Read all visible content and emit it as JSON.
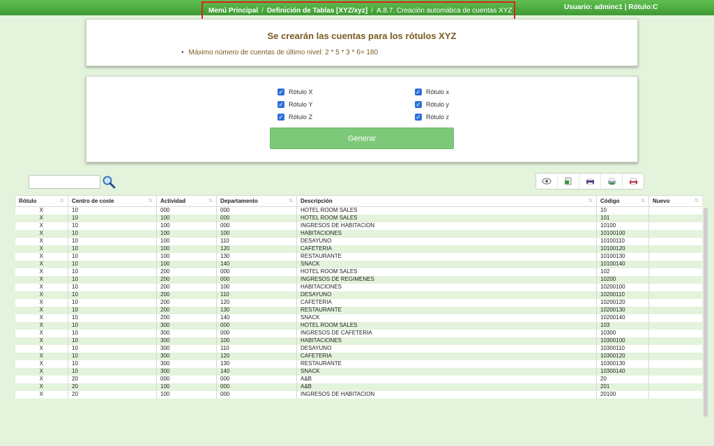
{
  "breadcrumb": {
    "items": [
      "Menú Principal",
      "Definición de Tablas [XYZ/xyz]"
    ],
    "current": "A.8.7. Creación automática de cuentas XYZ",
    "separator": "/"
  },
  "user": {
    "info": "Usuario: adminc1 | Rótulo:C"
  },
  "info_panel": {
    "title": "Se crearán las cuentas para los rótulos XYZ",
    "bullet": "Máximo número de cuentas de último nivel: 2 * 5 * 3 * 6= 180"
  },
  "options": [
    {
      "label": "Rótulo X",
      "checked": true
    },
    {
      "label": "Rótulo Y",
      "checked": true
    },
    {
      "label": "Rótulo Z",
      "checked": true
    },
    {
      "label": "Rótulo x",
      "checked": true
    },
    {
      "label": "Rótulo y",
      "checked": true
    },
    {
      "label": "Rótulo z",
      "checked": true
    }
  ],
  "generate_label": "Generar",
  "search": {
    "value": "",
    "icon": "magnifier-icon"
  },
  "toolbar_icons": [
    "eye-icon",
    "csv-icon",
    "print-icon",
    "copy-icon",
    "pdf-icon"
  ],
  "table": {
    "columns": [
      "Rótulo",
      "Centro de coste",
      "Actividad",
      "Departamento",
      "Descripción",
      "Código",
      "Nuevo"
    ],
    "rows": [
      [
        "X",
        "10",
        "000",
        "000",
        "HOTEL ROOM SALES",
        "10",
        ""
      ],
      [
        "X",
        "10",
        "100",
        "000",
        "HOTEL ROOM SALES",
        "101",
        ""
      ],
      [
        "X",
        "10",
        "100",
        "000",
        "INGRESOS DE HABITACION",
        "10100",
        ""
      ],
      [
        "X",
        "10",
        "100",
        "100",
        "HABITACIONES",
        "10100100",
        ""
      ],
      [
        "X",
        "10",
        "100",
        "110",
        "DESAYUNO",
        "10100110",
        ""
      ],
      [
        "X",
        "10",
        "100",
        "120",
        "CAFETERIA",
        "10100120",
        ""
      ],
      [
        "X",
        "10",
        "100",
        "130",
        "RESTAURANTE",
        "10100130",
        ""
      ],
      [
        "X",
        "10",
        "100",
        "140",
        "SNACK",
        "10100140",
        ""
      ],
      [
        "X",
        "10",
        "200",
        "000",
        "HOTEL ROOM SALES",
        "102",
        ""
      ],
      [
        "X",
        "10",
        "200",
        "000",
        "INGRESOS DE REGIMENES",
        "10200",
        ""
      ],
      [
        "X",
        "10",
        "200",
        "100",
        "HABITACIONES",
        "10200100",
        ""
      ],
      [
        "X",
        "10",
        "200",
        "110",
        "DESAYUNO",
        "10200110",
        ""
      ],
      [
        "X",
        "10",
        "200",
        "120",
        "CAFETERIA",
        "10200120",
        ""
      ],
      [
        "X",
        "10",
        "200",
        "130",
        "RESTAURANTE",
        "10200130",
        ""
      ],
      [
        "X",
        "10",
        "200",
        "140",
        "SNACK",
        "10200140",
        ""
      ],
      [
        "X",
        "10",
        "300",
        "000",
        "HOTEL ROOM SALES",
        "103",
        ""
      ],
      [
        "X",
        "10",
        "300",
        "000",
        "INGRESOS DE CAFETERIA",
        "10300",
        ""
      ],
      [
        "X",
        "10",
        "300",
        "100",
        "HABITACIONES",
        "10300100",
        ""
      ],
      [
        "X",
        "10",
        "300",
        "110",
        "DESAYUNO",
        "10300110",
        ""
      ],
      [
        "X",
        "10",
        "300",
        "120",
        "CAFETERIA",
        "10300120",
        ""
      ],
      [
        "X",
        "10",
        "300",
        "130",
        "RESTAURANTE",
        "10300130",
        ""
      ],
      [
        "X",
        "10",
        "300",
        "140",
        "SNACK",
        "10300140",
        ""
      ],
      [
        "X",
        "20",
        "000",
        "000",
        "A&B",
        "20",
        ""
      ],
      [
        "X",
        "20",
        "100",
        "000",
        "A&B",
        "201",
        ""
      ],
      [
        "X",
        "20",
        "100",
        "000",
        "INGRESOS DE HABITACION",
        "20100",
        ""
      ]
    ]
  }
}
